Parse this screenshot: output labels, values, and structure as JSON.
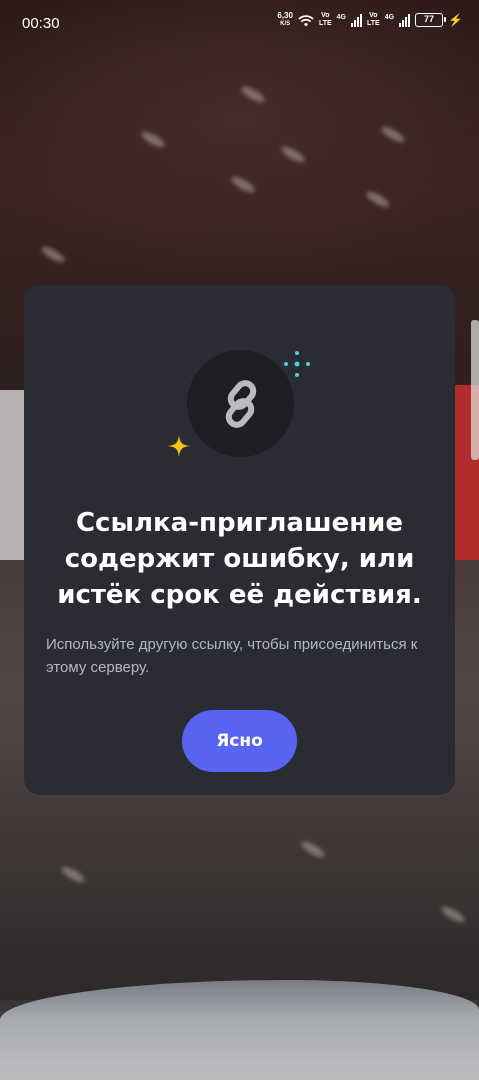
{
  "status_bar": {
    "time": "00:30",
    "net_speed_value": "6,30",
    "net_speed_unit": "K/S",
    "volte1_top": "Vo",
    "volte1_bottom": "LTE",
    "network1": "4G",
    "volte2_top": "Vo",
    "volte2_bottom": "LTE",
    "network2": "4G",
    "battery_level": "77",
    "icons": [
      "wifi-icon",
      "signal-icon",
      "signal-icon",
      "battery-icon",
      "charging-icon"
    ]
  },
  "modal": {
    "icon": "link-icon",
    "title": "Ссылка-приглашение содержит ошибку, или истёк срок её действия.",
    "description": "Используйте другую ссылку, чтобы присоединиться к этому серверу.",
    "ok_label": "Ясно"
  },
  "colors": {
    "modal_bg": "#2b2c33",
    "button": "#5865f2",
    "sparkle_yellow": "#f5c518",
    "sparkle_cyan": "#43d6e0"
  }
}
